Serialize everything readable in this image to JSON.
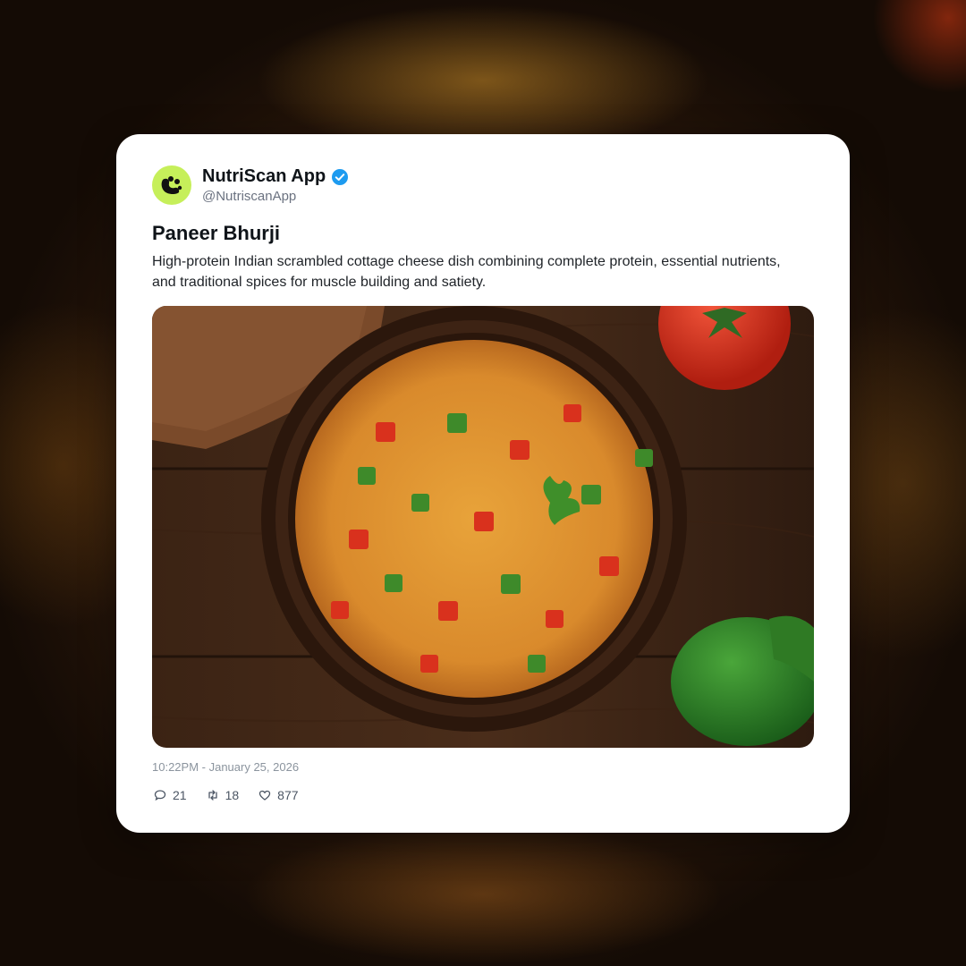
{
  "post": {
    "display_name": "NutriScan App",
    "handle": "@NutriscanApp",
    "title": "Paneer Bhurji",
    "body": "High-protein Indian scrambled cottage cheese dish combining complete protein, essential nutrients, and traditional spices for muscle building and satiety.",
    "timestamp": "10:22PM - January 25, 2026",
    "replies": "21",
    "reposts": "18",
    "likes": "877"
  },
  "icons": {
    "avatar": "nutriscan-logo-icon",
    "verified": "verified-badge-icon",
    "reply": "speech-bubble-icon",
    "repost": "repost-arrows-icon",
    "like": "heart-icon"
  },
  "colors": {
    "avatar_bg": "#c6ef5a",
    "verified": "#1d9bf0",
    "card_bg": "#ffffff"
  }
}
